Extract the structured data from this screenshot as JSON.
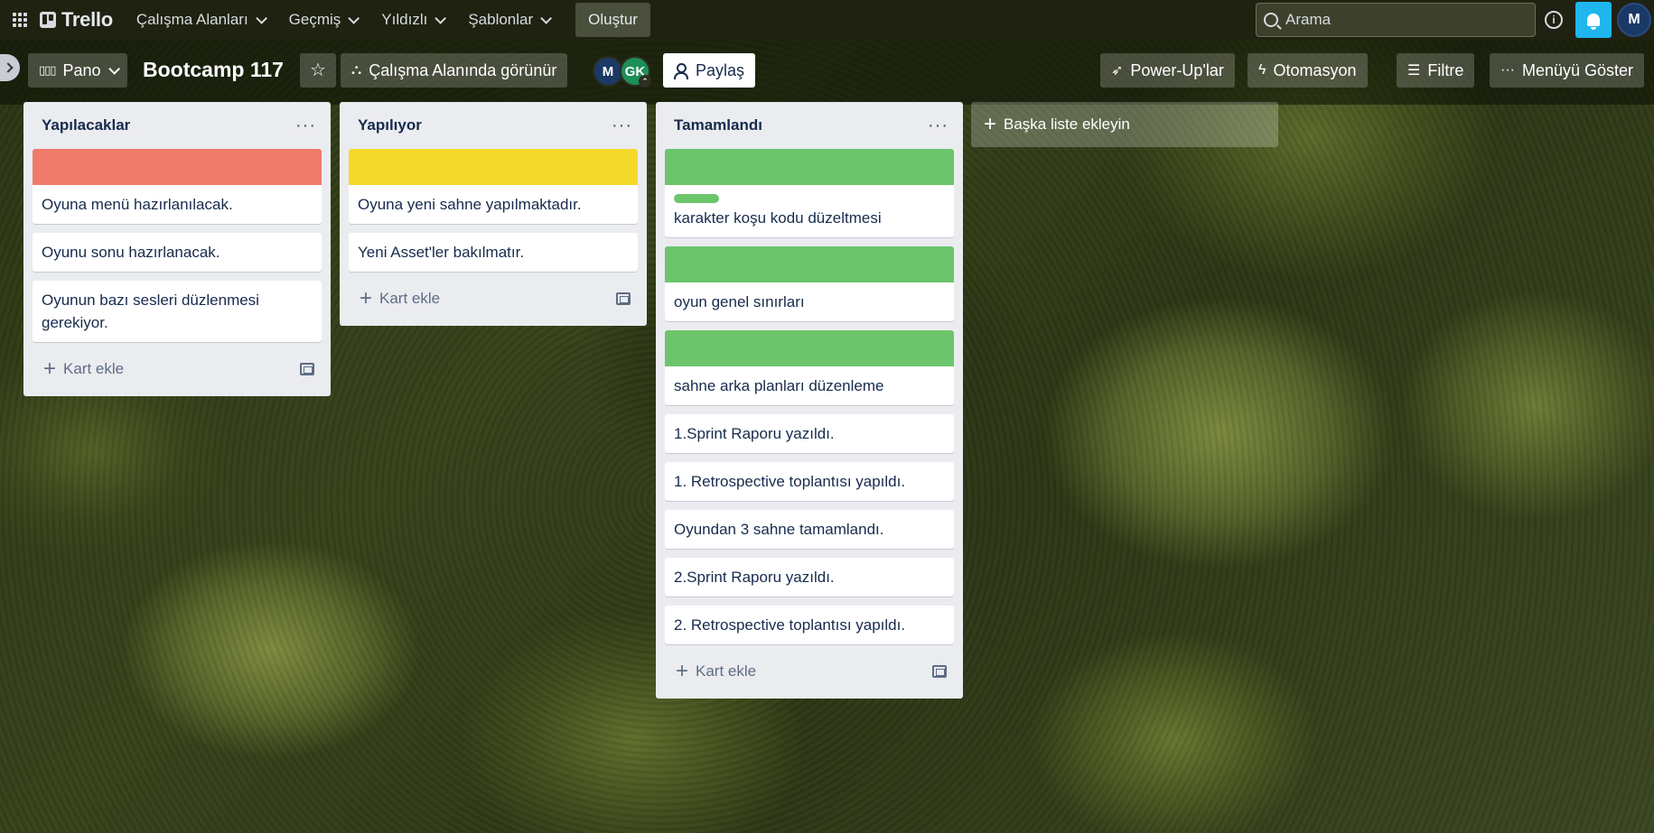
{
  "colors": {
    "red_label": "#f07b6b",
    "yellow_label": "#f5d92a",
    "green_label": "#6cc56a"
  },
  "topnav": {
    "logo": "Trello",
    "menus": [
      "Çalışma Alanları",
      "Geçmiş",
      "Yıldızlı",
      "Şablonlar"
    ],
    "create": "Oluştur",
    "search_placeholder": "Arama",
    "user_initial": "M"
  },
  "board": {
    "view": "Pano",
    "title": "Bootcamp 117",
    "visibility": "Çalışma Alanında görünür",
    "members": [
      "M",
      "GK"
    ],
    "share": "Paylaş",
    "powerups": "Power-Up'lar",
    "automation": "Otomasyon",
    "filter": "Filtre",
    "show_menu": "Menüyü Göster",
    "add_list": "Başka liste ekleyin"
  },
  "lists": [
    {
      "title": "Yapılacaklar",
      "cover": "red",
      "cards": [
        "Oyuna menü hazırlanılacak.",
        "Oyunu sonu hazırlanacak.",
        "Oyunun bazı sesleri düzlenmesi gerekiyor."
      ],
      "add_card": "Kart ekle"
    },
    {
      "title": "Yapılıyor",
      "cover": "yellow",
      "cards": [
        "Oyuna yeni sahne yapılmaktadır.",
        "Yeni Asset'ler bakılmatır."
      ],
      "add_card": "Kart ekle"
    },
    {
      "title": "Tamamlandı",
      "cover": "green",
      "cards": [
        "karakter koşu kodu düzeltmesi",
        "oyun genel sınırları",
        "sahne arka planları düzenleme",
        "1.Sprint Raporu yazıldı.",
        "1. Retrospective toplantısı yapıldı.",
        "Oyundan 3 sahne tamamlandı.",
        "2.Sprint Raporu yazıldı.",
        "2. Retrospective toplantısı yapıldı."
      ],
      "add_card": "Kart ekle"
    }
  ]
}
